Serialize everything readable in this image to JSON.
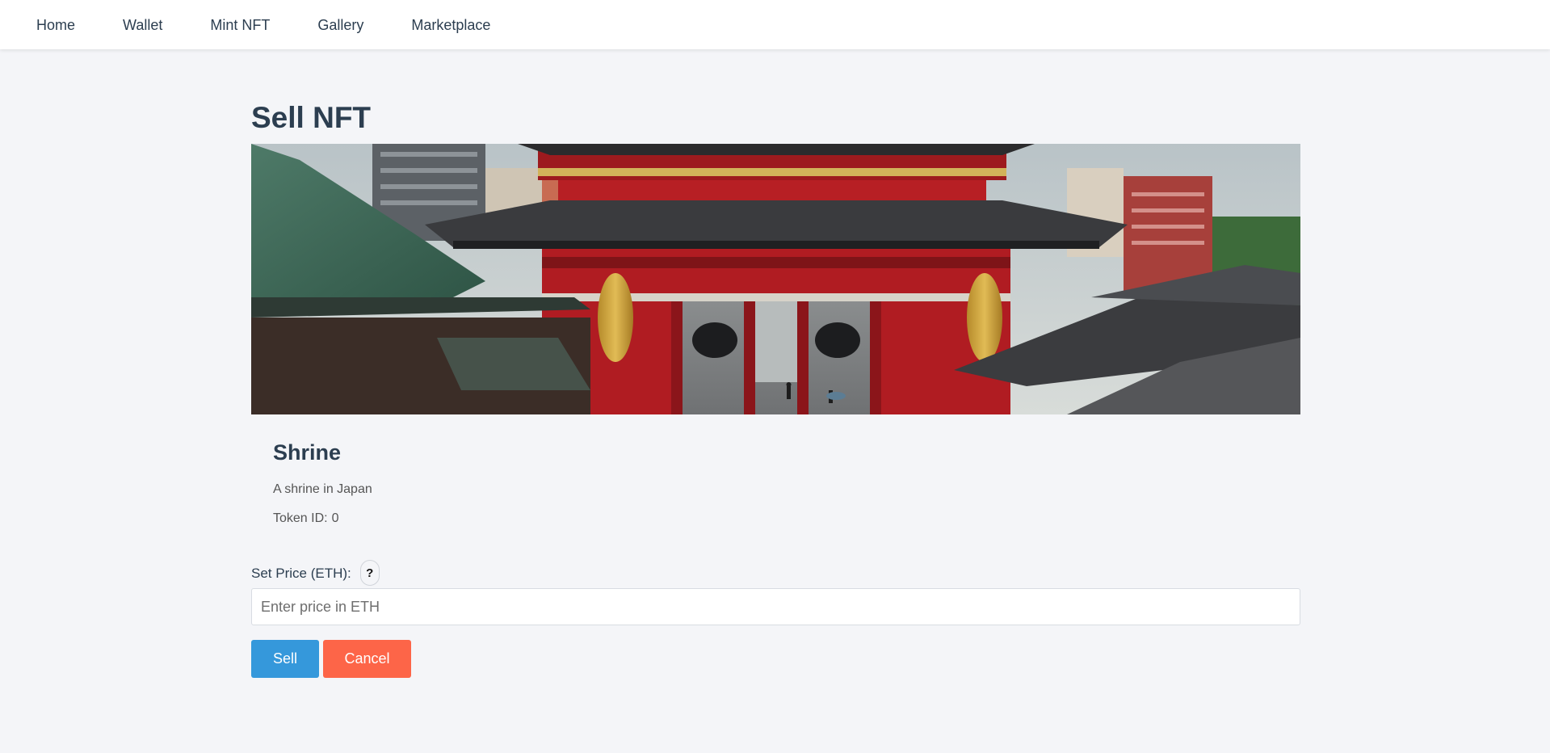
{
  "nav": {
    "items": [
      {
        "label": "Home"
      },
      {
        "label": "Wallet"
      },
      {
        "label": "Mint NFT"
      },
      {
        "label": "Gallery"
      },
      {
        "label": "Marketplace"
      }
    ]
  },
  "page": {
    "title": "Sell NFT"
  },
  "nft": {
    "name": "Shrine",
    "description": "A shrine in Japan",
    "token_label": "Token ID:",
    "token_id": "0"
  },
  "form": {
    "price_label": "Set Price (ETH):",
    "help_symbol": "?",
    "price_placeholder": "Enter price in ETH",
    "price_value": "",
    "sell_label": "Sell",
    "cancel_label": "Cancel"
  },
  "colors": {
    "background": "#f4f5f8",
    "text": "#2c3e50",
    "sell_button": "#3598db",
    "cancel_button": "#fd6548"
  }
}
